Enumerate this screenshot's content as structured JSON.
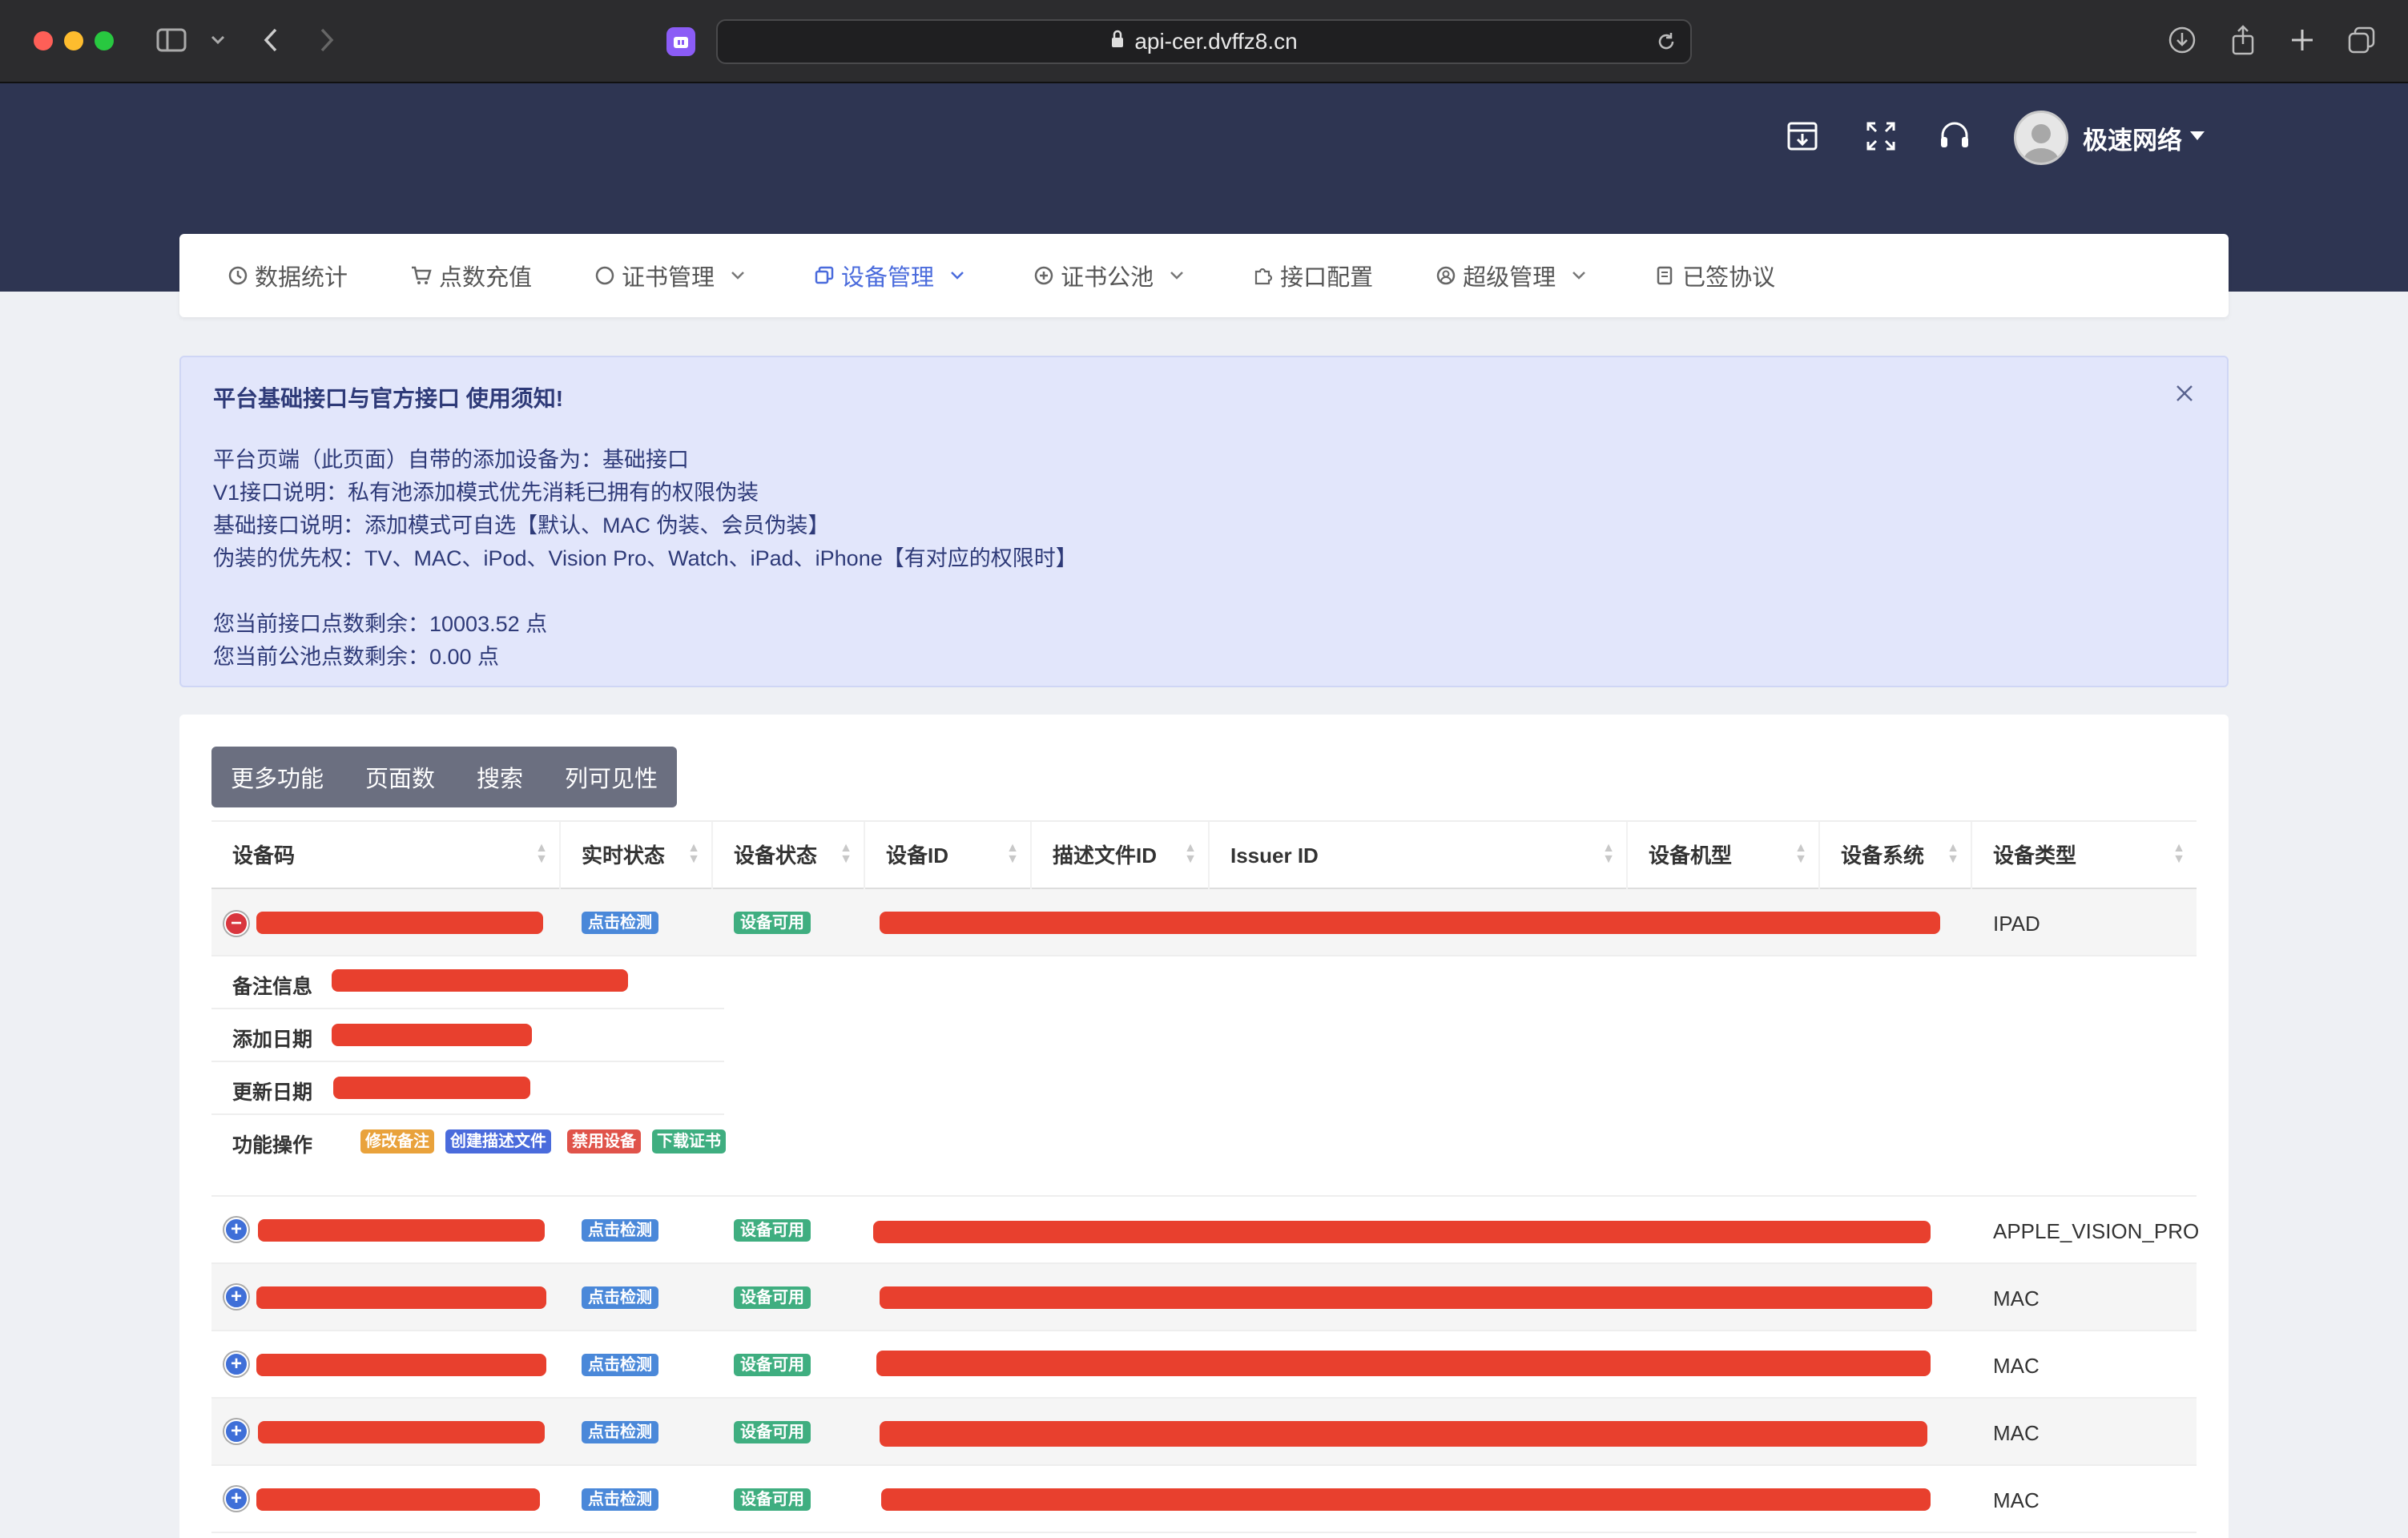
{
  "browser": {
    "url": "api-cer.dvffz8.cn"
  },
  "header": {
    "user_name": "极速网络"
  },
  "nav": {
    "items": [
      {
        "label": "数据统计",
        "icon": "clock-icon",
        "dropdown": false
      },
      {
        "label": "点数充值",
        "icon": "cart-icon",
        "dropdown": false
      },
      {
        "label": "证书管理",
        "icon": "circle-icon",
        "dropdown": true
      },
      {
        "label": "设备管理",
        "icon": "device-icon",
        "dropdown": true,
        "active": true
      },
      {
        "label": "证书公池",
        "icon": "plus-circle-icon",
        "dropdown": true
      },
      {
        "label": "接口配置",
        "icon": "puzzle-icon",
        "dropdown": false
      },
      {
        "label": "超级管理",
        "icon": "user-circle-icon",
        "dropdown": true
      },
      {
        "label": "已签协议",
        "icon": "document-icon",
        "dropdown": false
      }
    ]
  },
  "notice": {
    "title": "平台基础接口与官方接口 使用须知!",
    "lines": [
      "平台页端（此页面）自带的添加设备为：基础接口",
      "V1接口说明：私有池添加模式优先消耗已拥有的权限伪装",
      "基础接口说明：添加模式可自选【默认、MAC 伪装、会员伪装】",
      "伪装的优先权：TV、MAC、iPod、Vision Pro、Watch、iPad、iPhone【有对应的权限时】"
    ],
    "balance_lines": [
      "您当前接口点数剩余：10003.52 点",
      "您当前公池点数剩余：0.00 点"
    ]
  },
  "toolbar": {
    "buttons": [
      "更多功能",
      "页面数",
      "搜索",
      "列可见性"
    ]
  },
  "table": {
    "columns": [
      "设备码",
      "实时状态",
      "设备状态",
      "设备ID",
      "描述文件ID",
      "Issuer ID",
      "设备机型",
      "设备系统",
      "设备类型"
    ],
    "realtime_label": "点击检测",
    "rows": [
      {
        "status": "设备可用",
        "type": "IPAD",
        "expanded": true
      },
      {
        "status": "设备可用",
        "type": "APPLE_VISION_PRO",
        "expanded": false
      },
      {
        "status": "设备可用",
        "type": "MAC",
        "expanded": false
      },
      {
        "status": "设备可用",
        "type": "MAC",
        "expanded": false
      },
      {
        "status": "设备可用",
        "type": "MAC",
        "expanded": false
      },
      {
        "status": "设备可用",
        "type": "MAC",
        "expanded": false
      }
    ],
    "detail": {
      "labels": [
        "备注信息",
        "添加日期",
        "更新日期",
        "功能操作"
      ],
      "actions": [
        {
          "label": "修改备注",
          "color": "#e9a23b"
        },
        {
          "label": "创建描述文件",
          "color": "#4a6bdc"
        },
        {
          "label": "禁用设备",
          "color": "#e0534a"
        },
        {
          "label": "下载证书",
          "color": "#3fae80"
        }
      ]
    }
  }
}
